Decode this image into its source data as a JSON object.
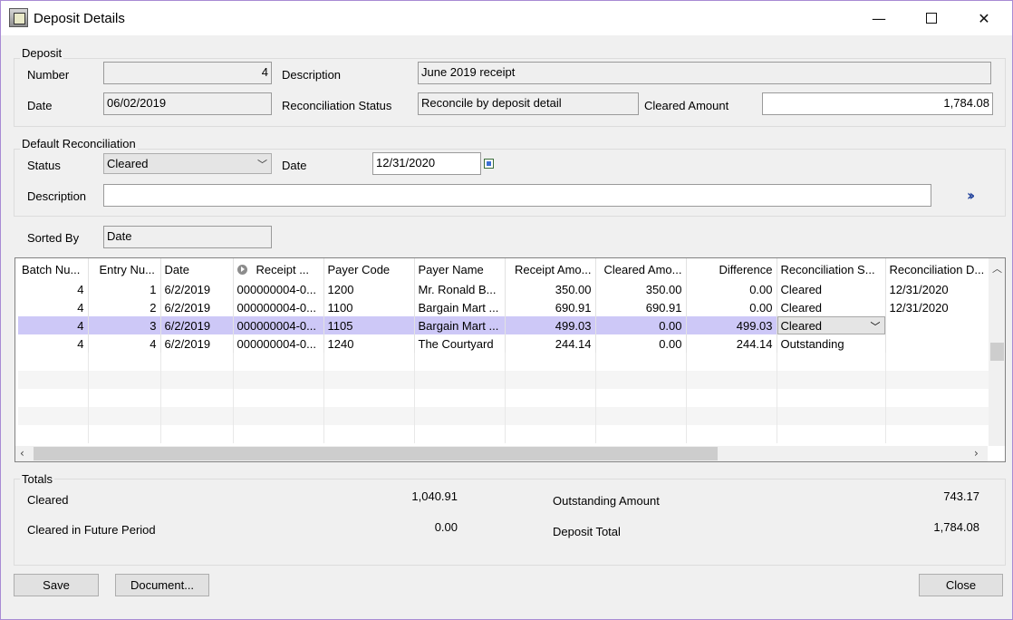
{
  "window": {
    "title": "Deposit Details",
    "min_glyph": "—",
    "close_glyph": "✕"
  },
  "deposit": {
    "group_label": "Deposit",
    "number_label": "Number",
    "number_value": "4",
    "description_label": "Description",
    "description_value": "June 2019 receipt",
    "date_label": "Date",
    "date_value": "06/02/2019",
    "recon_status_label": "Reconciliation Status",
    "recon_status_value": "Reconcile by deposit detail",
    "cleared_amount_label": "Cleared Amount",
    "cleared_amount_value": "1,784.08"
  },
  "default_reconciliation": {
    "group_label": "Default Reconciliation",
    "status_label": "Status",
    "status_value": "Cleared",
    "date_label": "Date",
    "date_value": "12/31/2020",
    "description_label": "Description",
    "description_value": ""
  },
  "sorted_by": {
    "label": "Sorted By",
    "value": "Date"
  },
  "grid": {
    "columns": [
      "Batch Nu...",
      "Entry Nu...",
      "Date",
      "Receipt ...",
      "Payer Code",
      "Payer Name",
      "Receipt Amo...",
      "Cleared Amo...",
      "Difference",
      "Reconciliation S...",
      "Reconciliation D..."
    ],
    "rows": [
      [
        "4",
        "1",
        "6/2/2019",
        "000000004-0...",
        "1200",
        "Mr. Ronald B...",
        "350.00",
        "350.00",
        "0.00",
        "Cleared",
        "12/31/2020"
      ],
      [
        "4",
        "2",
        "6/2/2019",
        "000000004-0...",
        "1100",
        "Bargain Mart ...",
        "690.91",
        "690.91",
        "0.00",
        "Cleared",
        "12/31/2020"
      ],
      [
        "4",
        "3",
        "6/2/2019",
        "000000004-0...",
        "1105",
        "Bargain Mart ...",
        "499.03",
        "0.00",
        "499.03",
        "Cleared",
        ""
      ],
      [
        "4",
        "4",
        "6/2/2019",
        "000000004-0...",
        "1240",
        "The Courtyard",
        "244.14",
        "0.00",
        "244.14",
        "Outstanding",
        ""
      ]
    ],
    "selected_row": 2
  },
  "totals": {
    "group_label": "Totals",
    "cleared_label": "Cleared",
    "cleared_value": "1,040.91",
    "future_label": "Cleared in Future Period",
    "future_value": "0.00",
    "outstanding_label": "Outstanding Amount",
    "outstanding_value": "743.17",
    "deposit_total_label": "Deposit Total",
    "deposit_total_value": "1,784.08"
  },
  "buttons": {
    "save": "Save",
    "document": "Document...",
    "close": "Close"
  }
}
